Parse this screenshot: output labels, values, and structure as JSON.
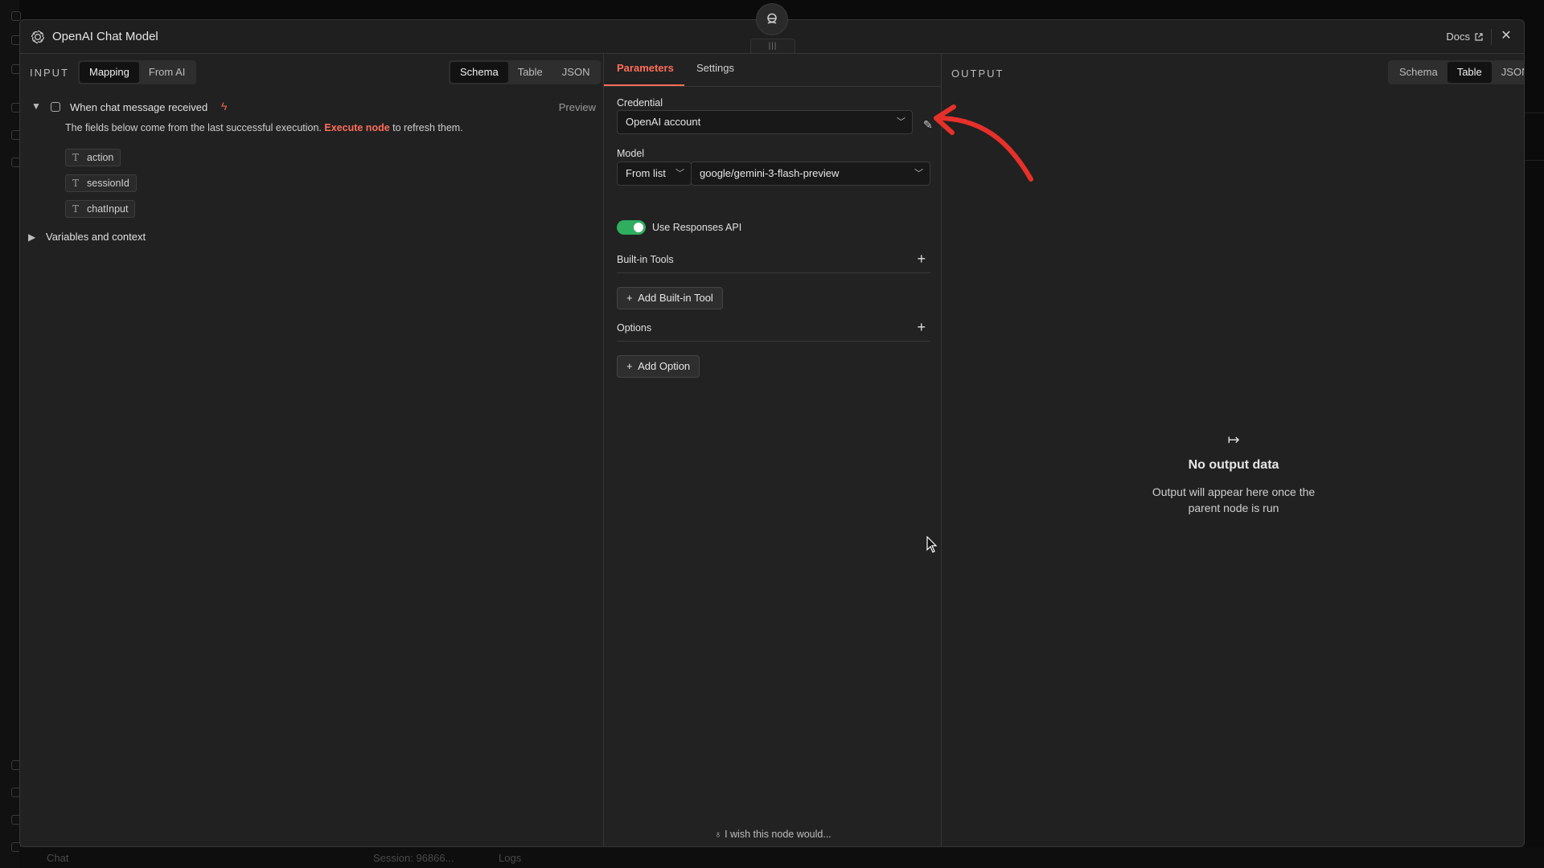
{
  "background": {
    "bottom_bar": {
      "chat": "Chat",
      "session": "Session: 96866...",
      "logs": "Logs"
    }
  },
  "modal": {
    "title": "OpenAI Chat Model",
    "docs_label": "Docs",
    "handle_glyph": "|||"
  },
  "input": {
    "label": "INPUT",
    "mode_tabs": [
      "Mapping",
      "From AI"
    ],
    "active_mode": "Mapping",
    "view_tabs": [
      "Schema",
      "Table",
      "JSON"
    ],
    "active_view": "Schema",
    "trigger": {
      "name": "When chat message received",
      "preview": "Preview"
    },
    "hint_prefix": "The fields below come from the last successful execution.",
    "hint_link": "Execute node",
    "hint_suffix": "to refresh them.",
    "type_glyph": "T",
    "fields": [
      "action",
      "sessionId",
      "chatInput"
    ],
    "variables_label": "Variables and context"
  },
  "parameters": {
    "tabs": [
      "Parameters",
      "Settings"
    ],
    "active_tab": "Parameters",
    "credential_label": "Credential",
    "credential_value": "OpenAI account",
    "model_label": "Model",
    "model_mode": "From list",
    "model_value": "google/gemini-3-flash-preview",
    "responses_api_label": "Use Responses API",
    "responses_api_enabled": true,
    "builtin_tools_label": "Built-in Tools",
    "add_builtin_tool": "Add Built-in Tool",
    "options_label": "Options",
    "add_option": "Add Option",
    "feedback": "I wish this node would..."
  },
  "output": {
    "label": "OUTPUT",
    "view_tabs": [
      "Schema",
      "Table",
      "JSON"
    ],
    "active_view": "Table",
    "empty_title": "No output data",
    "empty_subtitle": "Output will appear here once the parent node is run"
  },
  "colors": {
    "accent": "#ff6d5a",
    "toggle_on": "#2fae5f",
    "annotation_arrow": "#e8302a"
  }
}
